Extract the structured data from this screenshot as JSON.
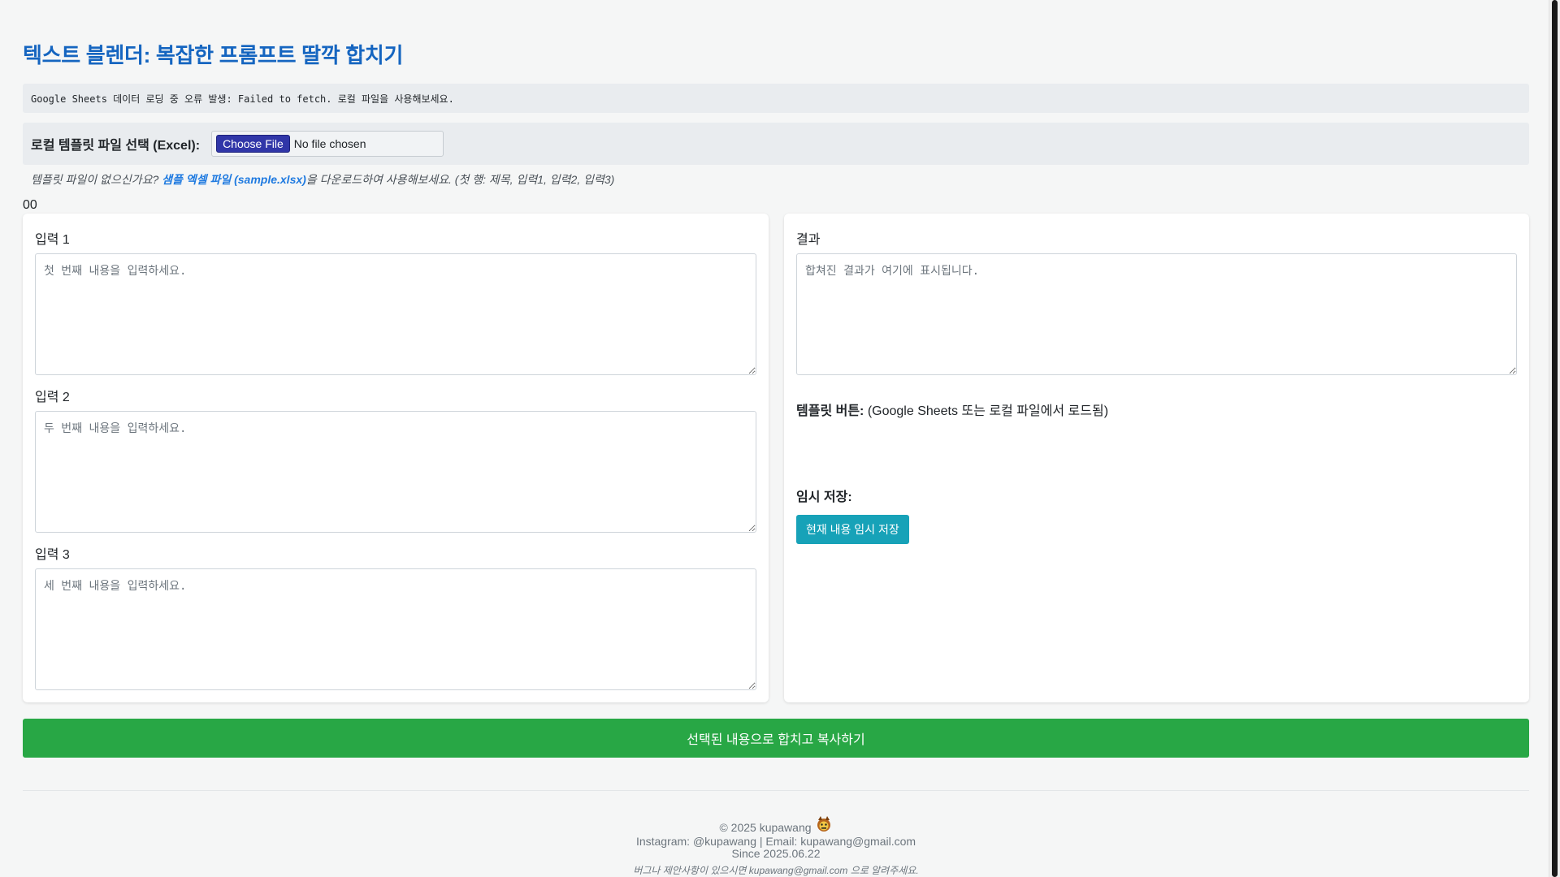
{
  "header": {
    "title": "텍스트 블렌더: 복잡한 프롬프트 딸깍 합치기"
  },
  "error": {
    "message": "Google Sheets 데이터 로딩 중 오류 발생: Failed to fetch. 로컬 파일을 사용해보세요."
  },
  "file_select": {
    "label": "로컬 템플릿 파일 선택 (Excel):",
    "button_label": "Choose File",
    "status": "No file chosen"
  },
  "hint": {
    "prefix": "템플릿 파일이 없으신가요? ",
    "link_text": "샘플 엑셀 파일 (sample.xlsx)",
    "suffix": "을 다운로드하여 사용해보세요. (첫 행: 제목, 입력1, 입력2, 입력3)"
  },
  "counter": "00",
  "inputs": [
    {
      "label": "입력 1",
      "placeholder": "첫 번째 내용을 입력하세요.",
      "value": ""
    },
    {
      "label": "입력 2",
      "placeholder": "두 번째 내용을 입력하세요.",
      "value": ""
    },
    {
      "label": "입력 3",
      "placeholder": "세 번째 내용을 입력하세요.",
      "value": ""
    }
  ],
  "result": {
    "label": "결과",
    "placeholder": "합쳐진 결과가 여기에 표시됩니다."
  },
  "templates": {
    "title": "템플릿 버튼:",
    "description": " (Google Sheets 또는 로컬 파일에서 로드됨)"
  },
  "temp_save": {
    "title": "임시 저장:",
    "button_label": "현재 내용 임시 저장"
  },
  "merge_button": {
    "label": "선택된 내용으로 합치고 복사하기"
  },
  "footer": {
    "copyright": "© 2025 kupawang",
    "contact": "Instagram: @kupawang | Email: kupawang@gmail.com",
    "since": "Since 2025.06.22",
    "note": "버그나 제안사항이 있으시면 kupawang@gmail.com 으로 알려주세요."
  },
  "colors": {
    "title": "#1565c0",
    "merge_button": "#28a745",
    "save_button": "#17a2b8",
    "link": "#1f7ae0"
  }
}
